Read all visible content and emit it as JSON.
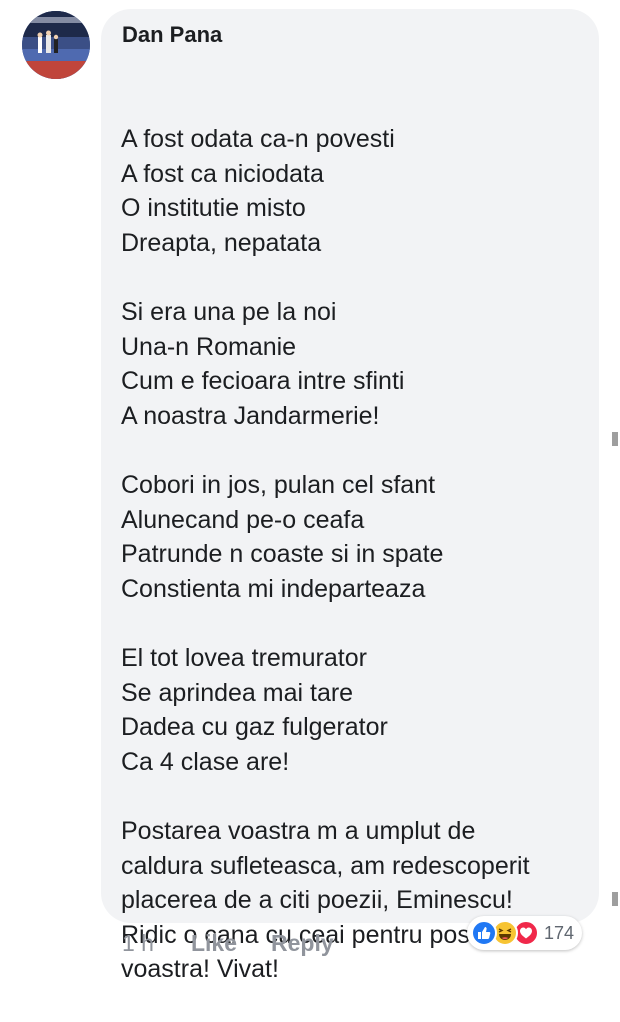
{
  "comment": {
    "author": "Dan Pana",
    "lines": [
      "A fost odata ca-n povesti",
      "A fost ca niciodata",
      "O institutie misto",
      "Dreapta, nepatata",
      "",
      "Si era una pe la noi",
      "Una-n Romanie",
      "Cum e fecioara intre sfinti",
      "A noastra Jandarmerie!",
      "",
      "Cobori in jos, pulan cel sfant",
      "Alunecand pe-o ceafa",
      "Patrunde n coaste si in spate",
      "Constienta mi indeparteaza",
      "",
      "El tot lovea tremurator",
      "Se aprindea mai tare",
      "Dadea cu gaz fulgerator",
      "Ca 4 clase are!",
      "",
      "Postarea voastra m a umplut de",
      "caldura sufleteasca, am redescoperit",
      "placerea de a citi poezii, Eminescu!",
      "Ridic o cana cu ceai pentru postarea",
      "voastra! Vivat!"
    ],
    "time": "1 h",
    "like_label": "Like",
    "reply_label": "Reply",
    "reactions": {
      "icons": [
        "like-icon",
        "haha-icon",
        "love-icon"
      ],
      "count": "174"
    }
  },
  "colors": {
    "bubble_bg": "#f2f3f5",
    "text": "#1c1e21",
    "meta": "#90949c",
    "like_blue": "#2078f4",
    "haha_yellow": "#f7c433",
    "love_red": "#f0284a"
  }
}
